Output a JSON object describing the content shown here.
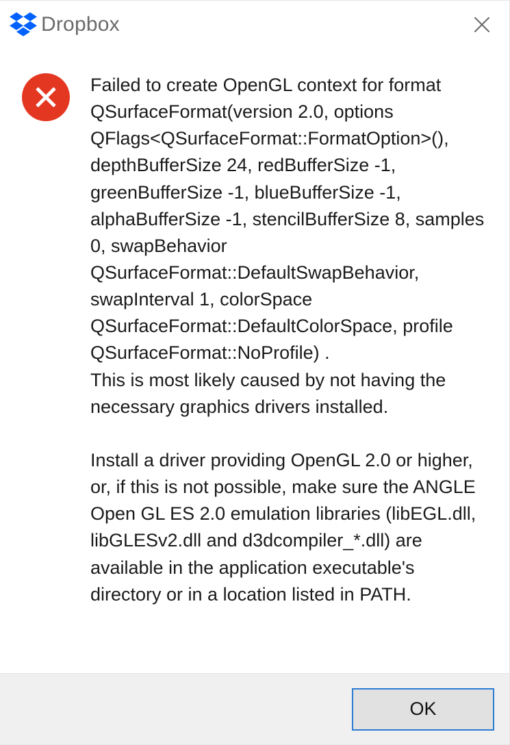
{
  "titlebar": {
    "app_name": "Dropbox",
    "brand_color": "#0061fe"
  },
  "icons": {
    "error_bg": "#e43721",
    "close_stroke": "#6a6a6a"
  },
  "message": {
    "text": "Failed to create OpenGL context for format QSurfaceFormat(version 2.0, options QFlags<QSurfaceFormat::FormatOption>(), depthBufferSize 24, redBufferSize -1, greenBufferSize -1, blueBufferSize -1, alphaBufferSize -1, stencilBufferSize 8, samples 0, swapBehavior QSurfaceFormat::DefaultSwapBehavior, swapInterval 1, colorSpace QSurfaceFormat::DefaultColorSpace, profile  QSurfaceFormat::NoProfile) .\nThis is most likely caused by not having the necessary graphics drivers installed.\n\nInstall a driver providing OpenGL 2.0 or higher, or, if this is not possible, make sure the ANGLE Open GL ES 2.0 emulation libraries (libEGL.dll, libGLESv2.dll and d3dcompiler_*.dll) are available in the application executable's directory or in a location listed in PATH."
  },
  "buttons": {
    "ok_label": "OK"
  }
}
